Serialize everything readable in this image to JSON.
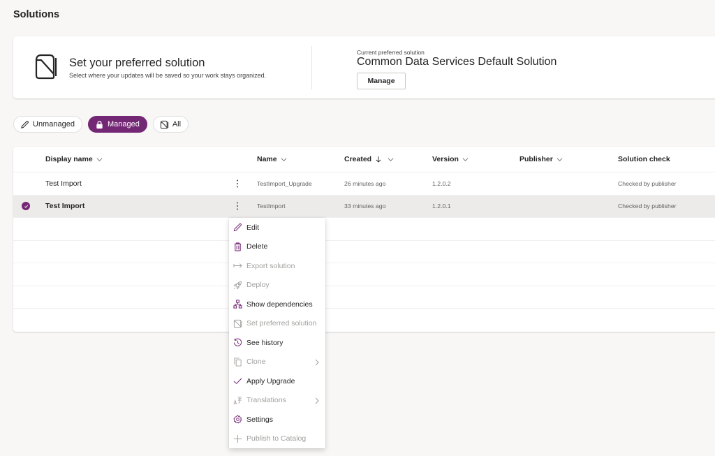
{
  "page": {
    "title": "Solutions"
  },
  "hero": {
    "title": "Set your preferred solution",
    "subtitle": "Select where your updates will be saved so your work stays organized.",
    "current_label": "Current preferred solution",
    "current_value": "Common Data Services Default Solution",
    "manage_label": "Manage",
    "icon": "preferred-solution-icon"
  },
  "filters": [
    {
      "label": "Unmanaged",
      "icon": "pencil-icon",
      "active": false
    },
    {
      "label": "Managed",
      "icon": "lock-icon",
      "active": true
    },
    {
      "label": "All",
      "icon": "solution-icon",
      "active": false
    }
  ],
  "theme": {
    "accent": "#742774",
    "selected_row": "#edebe9",
    "disabled_text": "#a19f9d"
  },
  "grid": {
    "columns": [
      {
        "label": "Display name",
        "sortable": true
      },
      {
        "label": "Name",
        "sortable": true
      },
      {
        "label": "Created",
        "sort": "descending",
        "sortable": true
      },
      {
        "label": "Version",
        "sortable": true
      },
      {
        "label": "Publisher",
        "sortable": true
      },
      {
        "label": "Solution check",
        "sortable": false
      }
    ],
    "rows": [
      {
        "display_name": "Test Import",
        "name": "TestImport_Upgrade",
        "created": "26 minutes ago",
        "version": "1.2.0.2",
        "publisher": "",
        "solution_check": "Checked by publisher",
        "selected": false
      },
      {
        "display_name": "Test Import",
        "name": "TestImport",
        "created": "33 minutes ago",
        "version": "1.2.0.1",
        "publisher": "",
        "solution_check": "Checked by publisher",
        "selected": true
      }
    ]
  },
  "context_menu": {
    "items": [
      {
        "label": "Edit",
        "icon": "pencil-icon",
        "disabled": false,
        "submenu": false
      },
      {
        "label": "Delete",
        "icon": "trash-icon",
        "disabled": false,
        "submenu": false
      },
      {
        "label": "Export solution",
        "icon": "export-arrow-icon",
        "disabled": true,
        "submenu": false
      },
      {
        "label": "Deploy",
        "icon": "rocket-icon",
        "disabled": true,
        "submenu": false
      },
      {
        "label": "Show dependencies",
        "icon": "hierarchy-icon",
        "disabled": false,
        "submenu": false
      },
      {
        "label": "Set preferred solution",
        "icon": "solution-icon",
        "disabled": true,
        "submenu": false
      },
      {
        "label": "See history",
        "icon": "history-icon",
        "disabled": false,
        "submenu": false
      },
      {
        "label": "Clone",
        "icon": "copy-icon",
        "disabled": true,
        "submenu": true
      },
      {
        "label": "Apply Upgrade",
        "icon": "checkmark-icon",
        "disabled": false,
        "submenu": false
      },
      {
        "label": "Translations",
        "icon": "translate-icon",
        "disabled": true,
        "submenu": true
      },
      {
        "label": "Settings",
        "icon": "gear-icon",
        "disabled": false,
        "submenu": false
      },
      {
        "label": "Publish to Catalog",
        "icon": "plus-icon",
        "disabled": true,
        "submenu": false
      }
    ]
  }
}
